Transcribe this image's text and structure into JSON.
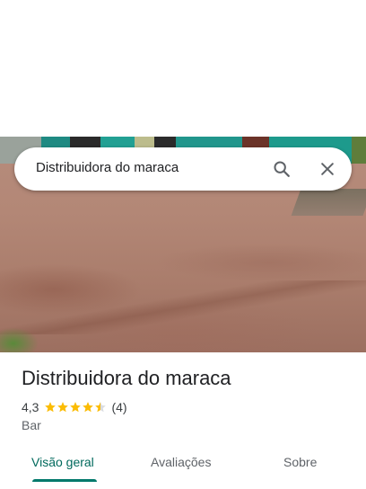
{
  "search": {
    "query": "Distribuidora do maraca",
    "search_icon": "search-icon",
    "close_icon": "close-icon"
  },
  "place": {
    "name": "Distribuidora do maraca",
    "rating_text": "4,3",
    "rating_value": 4.3,
    "rating_max": 5,
    "review_count": "(4)",
    "category": "Bar"
  },
  "tabs": [
    {
      "label": "Visão geral",
      "active": true
    },
    {
      "label": "Avaliações",
      "active": false
    },
    {
      "label": "Sobre",
      "active": false
    }
  ],
  "colors": {
    "star": "#fbbc04",
    "star_empty": "#dadce0",
    "active_tab": "#00796b",
    "text_primary": "#202124",
    "text_secondary": "#5f6368"
  }
}
